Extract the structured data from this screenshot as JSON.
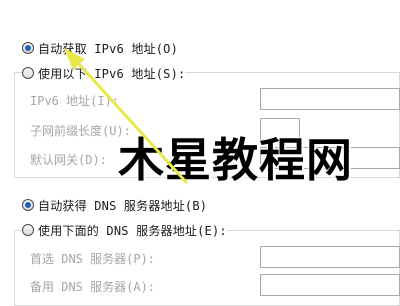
{
  "ipv6": {
    "auto_label": "自动获取 IPv6 地址(O)",
    "manual_label": "使用以下 IPv6 地址(S):",
    "address_label": "IPv6 地址(I):",
    "prefix_label": "子网前缀长度(U):",
    "gateway_label": "默认网关(D):",
    "auto_selected": true
  },
  "dns": {
    "auto_label": "自动获得 DNS 服务器地址(B)",
    "manual_label": "使用下面的 DNS 服务器地址(E):",
    "preferred_label": "首选 DNS 服务器(P):",
    "alternate_label": "备用 DNS 服务器(A):",
    "auto_selected": true
  },
  "watermark": {
    "text": "木星教程网"
  },
  "colors": {
    "radio_dot": "#1f5fbf",
    "arrow": "#e8e84a",
    "disabled_text": "#a6a6a6"
  }
}
